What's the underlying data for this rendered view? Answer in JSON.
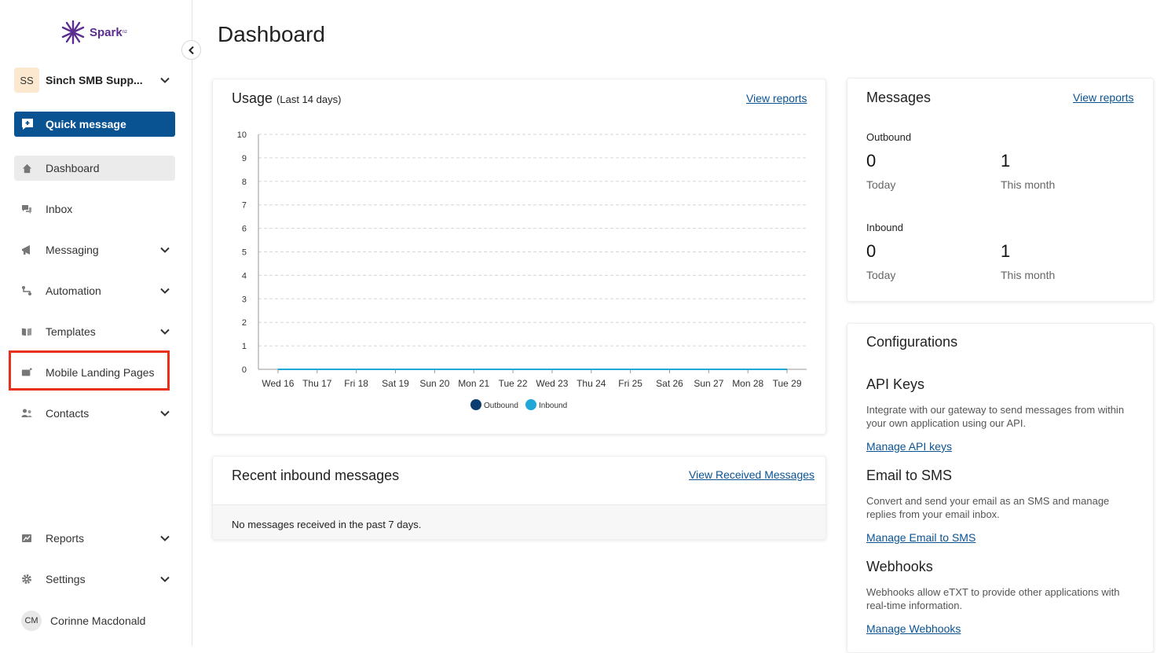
{
  "sidebar": {
    "logo_text": "Spark",
    "logo_sup": "nz",
    "account": {
      "initials": "SS",
      "name": "Sinch SMB Supp..."
    },
    "quick_message": "Quick message",
    "items": [
      {
        "label": "Dashboard",
        "icon": "home-icon",
        "active": true
      },
      {
        "label": "Inbox",
        "icon": "chat-icon"
      },
      {
        "label": "Messaging",
        "icon": "megaphone-icon"
      },
      {
        "label": "Automation",
        "icon": "flow-icon"
      },
      {
        "label": "Templates",
        "icon": "book-icon"
      },
      {
        "label": "Mobile Landing Pages",
        "icon": "landing-page-icon"
      },
      {
        "label": "Contacts",
        "icon": "users-icon"
      },
      {
        "label": "Reports",
        "icon": "chart-icon"
      },
      {
        "label": "Settings",
        "icon": "gear-icon"
      }
    ],
    "user": {
      "initials": "CM",
      "name": "Corinne Macdonald"
    }
  },
  "main": {
    "title": "Dashboard",
    "usage": {
      "title": "Usage",
      "subtitle": "(Last 14 days)",
      "link": "View reports"
    },
    "recent": {
      "title": "Recent inbound messages",
      "link": "View Received Messages",
      "empty": "No messages received in the past 7 days."
    },
    "messages": {
      "title": "Messages",
      "link": "View reports",
      "outbound": {
        "label": "Outbound",
        "today": "0",
        "today_label": "Today",
        "month": "1",
        "month_label": "This month"
      },
      "inbound": {
        "label": "Inbound",
        "today": "0",
        "today_label": "Today",
        "month": "1",
        "month_label": "This month"
      }
    },
    "config": {
      "title": "Configurations",
      "sections": [
        {
          "heading": "API Keys",
          "desc": "Integrate with our gateway to send messages from within your own application using our API.",
          "link": "Manage API keys"
        },
        {
          "heading": "Email to SMS",
          "desc": "Convert and send your email as an SMS and manage replies from your email inbox.",
          "link": "Manage Email to SMS"
        },
        {
          "heading": "Webhooks",
          "desc": "Webhooks allow eTXT to provide other applications with real-time information.",
          "link": "Manage Webhooks"
        }
      ]
    }
  },
  "chart_data": {
    "type": "line",
    "categories": [
      "Wed 16",
      "Thu 17",
      "Fri 18",
      "Sat 19",
      "Sun 20",
      "Mon 21",
      "Tue 22",
      "Wed 23",
      "Thu 24",
      "Fri 25",
      "Sat 26",
      "Sun 27",
      "Mon 28",
      "Tue 29"
    ],
    "yticks": [
      "0",
      "1",
      "2",
      "3",
      "4",
      "5",
      "6",
      "7",
      "8",
      "9",
      "10"
    ],
    "ylim": [
      0,
      10
    ],
    "series": [
      {
        "name": "Outbound",
        "color": "#0b3d6e",
        "values": [
          0,
          0,
          0,
          0,
          0,
          0,
          0,
          0,
          0,
          0,
          0,
          0,
          0,
          0
        ]
      },
      {
        "name": "Inbound",
        "color": "#1ea7d7",
        "values": [
          0,
          0,
          0,
          0,
          0,
          0,
          0,
          0,
          0,
          0,
          0,
          0,
          0,
          0
        ]
      }
    ],
    "grid": true,
    "legend": "bottom"
  }
}
